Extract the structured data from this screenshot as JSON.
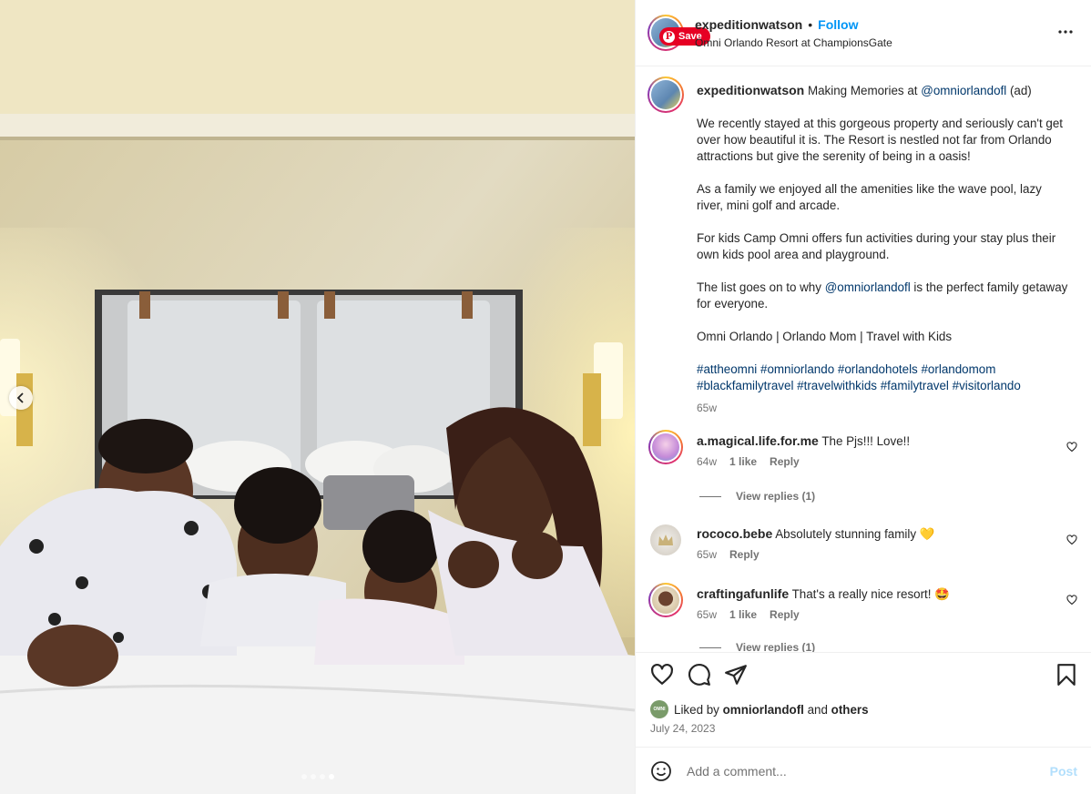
{
  "post": {
    "author": "expeditionwatson",
    "separator": "•",
    "follow_label": "Follow",
    "location": "Omni Orlando Resort at ChampionsGate",
    "save_label": "Save",
    "save_pin_glyph": "P"
  },
  "caption": {
    "author": "expeditionwatson",
    "line1_text": " Making Memories at ",
    "line1_mention": "@omniorlandofl",
    "line1_suffix": " (ad)",
    "p2": "We recently stayed at this gorgeous property and seriously can't get over how beautiful it is. The Resort is nestled not far from Orlando attractions but give the serenity of being in a oasis!",
    "p3": "As a family we enjoyed all the amenities like the wave pool, lazy river, mini golf and arcade.",
    "p4": "For kids Camp Omni offers fun activities during your stay plus their own kids pool area and playground.",
    "p5_pre": "The list goes on to why ",
    "p5_mention": "@omniorlandofl",
    "p5_post": " is the perfect family getaway for everyone.",
    "p6": "Omni Orlando | Orlando Mom | Travel with Kids",
    "hashtags": [
      "#attheomni",
      "#omniorlando",
      "#orlandohotels",
      "#orlandomom",
      "#blackfamilytravel",
      "#travelwithkids",
      "#familytravel",
      "#visitorlando"
    ],
    "time": "65w"
  },
  "comments": [
    {
      "user": "a.magical.life.for.me",
      "text": "The Pjs!!! Love!!",
      "time": "64w",
      "likes": "1 like",
      "reply": "Reply",
      "view_replies": "View replies (1)"
    },
    {
      "user": "rococo.bebe",
      "text": "Absolutely stunning family",
      "emoji": "💛",
      "time": "65w",
      "reply": "Reply"
    },
    {
      "user": "craftingafunlife",
      "text": "That's a really nice resort!",
      "emoji": "🤩",
      "time": "65w",
      "likes": "1 like",
      "reply": "Reply",
      "view_replies": "View replies (1)"
    }
  ],
  "likes": {
    "prefix": "Liked by ",
    "user": "omniorlandofl",
    "and": " and ",
    "others": "others",
    "avatar_text": "OMNI",
    "date": "July 24, 2023"
  },
  "add_comment": {
    "placeholder": "Add a comment...",
    "post_label": "Post"
  },
  "carousel": {
    "count": 4,
    "active_index": 3
  },
  "colors": {
    "accent": "#0095f6",
    "link": "#00376b",
    "pinterest": "#e60023",
    "muted": "#737373"
  },
  "icons": [
    "chevron-left-icon",
    "more-icon",
    "heart-icon",
    "comment-icon",
    "share-icon",
    "bookmark-icon",
    "emoji-icon"
  ]
}
